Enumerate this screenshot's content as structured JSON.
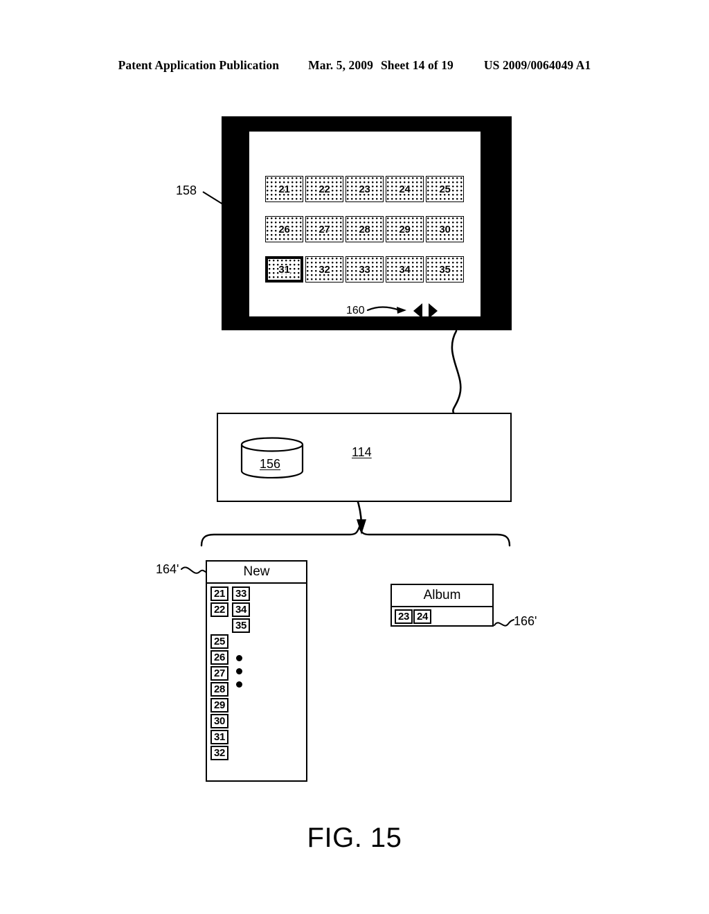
{
  "header": {
    "publication": "Patent Application Publication",
    "date": "Mar. 5, 2009",
    "sheet": "Sheet 14 of 19",
    "patent_number": "US 2009/0064049 A1"
  },
  "figure": {
    "caption": "FIG. 15"
  },
  "device": {
    "ref": "158",
    "nav": {
      "ref": "160",
      "prev_icon": "triangle-left-icon",
      "next_icon": "triangle-right-icon"
    },
    "grid": {
      "columns": 5,
      "rows": 3,
      "selected": "31",
      "items": [
        "21",
        "22",
        "23",
        "24",
        "25",
        "26",
        "27",
        "28",
        "29",
        "30",
        "31",
        "32",
        "33",
        "34",
        "35"
      ]
    }
  },
  "system": {
    "ref": "114",
    "database": {
      "ref": "156",
      "icon": "database-cylinder-icon"
    }
  },
  "windows": {
    "new": {
      "ref": "164'",
      "title": "New",
      "column_left": [
        "21",
        "22",
        "",
        "25",
        "26",
        "27",
        "28",
        "29",
        "30",
        "31",
        "32"
      ],
      "column_right": [
        "33",
        "34",
        "35"
      ],
      "ellipsis_dots": 3
    },
    "album": {
      "ref": "166'",
      "title": "Album",
      "items": [
        "23",
        "24"
      ]
    }
  },
  "colors": {
    "ink": "#000000",
    "paper": "#ffffff"
  }
}
